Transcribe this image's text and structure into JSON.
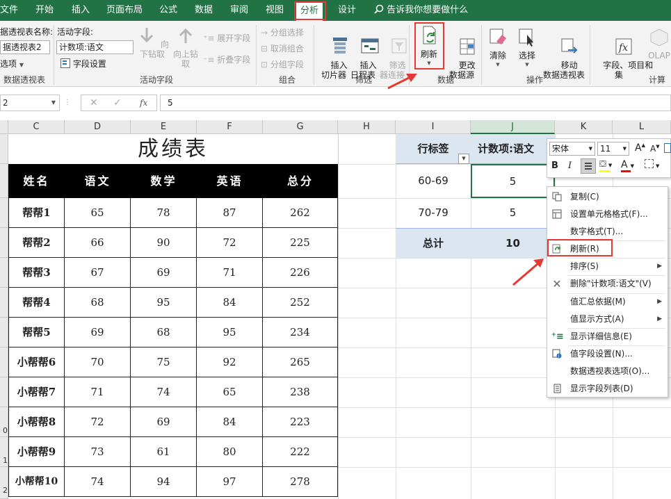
{
  "ribbon_tabs": [
    "文件",
    "开始",
    "插入",
    "页面布局",
    "公式",
    "数据",
    "审阅",
    "视图",
    "分析",
    "设计"
  ],
  "active_tab": "分析",
  "tell_me": "告诉我你想要做什么",
  "pivot": {
    "name_label": "据透视表名称:",
    "name_value": "据透视表2",
    "options_label": "选项",
    "group_label": "数据透视表"
  },
  "active_field": {
    "label": "活动字段:",
    "value": "计数项:语文",
    "settings": "字段设置",
    "drill_down": "向下钻取",
    "drill_up": "向上钻取",
    "expand": "展开字段",
    "collapse": "折叠字段",
    "group_label": "活动字段"
  },
  "group": {
    "selection": "分组选择",
    "ungroup": "取消组合",
    "field": "分组字段",
    "group_label": "组合"
  },
  "filter": {
    "slicer": "插入\n切片器",
    "timeline": "插入\n日程表",
    "connections": "筛选\n器连接",
    "group_label": "筛选"
  },
  "data": {
    "refresh": "刷新",
    "change_source": "更改\n数据源",
    "group_label": "数据"
  },
  "actions": {
    "clear": "清除",
    "select": "选择",
    "move": "移动\n数据透视表",
    "group_label": "操作"
  },
  "calc": {
    "fields": "字段、项目和\n集",
    "olap": "OLAP",
    "group_label": "计算"
  },
  "formula_bar": {
    "name_box": "2",
    "fx": "fx",
    "value": "5"
  },
  "columns": [
    "C",
    "D",
    "E",
    "F",
    "G",
    "H",
    "I",
    "J",
    "K",
    "L"
  ],
  "row_numbers": [
    "0",
    "1",
    "2"
  ],
  "table": {
    "title": "成绩表",
    "headers": [
      "姓名",
      "语文",
      "数学",
      "英语",
      "总分"
    ],
    "rows": [
      [
        "帮帮1",
        "65",
        "78",
        "87",
        "262"
      ],
      [
        "帮帮2",
        "66",
        "90",
        "72",
        "225"
      ],
      [
        "帮帮3",
        "67",
        "69",
        "71",
        "226"
      ],
      [
        "帮帮4",
        "68",
        "95",
        "84",
        "252"
      ],
      [
        "帮帮5",
        "69",
        "68",
        "95",
        "234"
      ],
      [
        "小帮帮6",
        "70",
        "75",
        "92",
        "265"
      ],
      [
        "小帮帮7",
        "71",
        "74",
        "65",
        "238"
      ],
      [
        "小帮帮8",
        "72",
        "69",
        "84",
        "223"
      ],
      [
        "小帮帮9",
        "73",
        "61",
        "80",
        "222"
      ],
      [
        "小帮帮10",
        "74",
        "94",
        "97",
        "278"
      ]
    ]
  },
  "pivot_table": {
    "row_label": "行标签",
    "value_header": "计数项:语文",
    "rows": [
      [
        "60-69",
        "5"
      ],
      [
        "70-79",
        "5"
      ]
    ],
    "total_label": "总计",
    "total_value": "10"
  },
  "mini_toolbar": {
    "font": "宋体",
    "size": "11",
    "grow": "A",
    "shrink": "A",
    "bold": "B",
    "italic": "I",
    "font_color_letter": "A"
  },
  "context_menu": [
    {
      "label": "复制(C)",
      "icon": "copy-icon",
      "submenu": false
    },
    {
      "label": "设置单元格格式(F)...",
      "icon": "format-cells-icon",
      "submenu": false
    },
    {
      "label": "数字格式(T)...",
      "icon": "",
      "submenu": false
    },
    {
      "label": "刷新(R)",
      "icon": "refresh-icon",
      "submenu": false
    },
    {
      "label": "排序(S)",
      "icon": "",
      "submenu": true
    },
    {
      "label": "删除\"计数项:语文\"(V)",
      "icon": "delete-x-icon",
      "submenu": false
    },
    {
      "label": "值汇总依据(M)",
      "icon": "",
      "submenu": true
    },
    {
      "label": "值显示方式(A)",
      "icon": "",
      "submenu": true
    },
    {
      "label": "显示详细信息(E)",
      "icon": "show-details-icon",
      "submenu": false
    },
    {
      "label": "值字段设置(N)...",
      "icon": "field-settings-icon",
      "submenu": false
    },
    {
      "label": "数据透视表选项(O)...",
      "icon": "",
      "submenu": false
    },
    {
      "label": "显示字段列表(D)",
      "icon": "field-list-icon",
      "submenu": false
    }
  ],
  "colors": {
    "excel_green": "#217346",
    "highlight_red": "#e53935",
    "pivot_header_bg": "#dce6f1"
  }
}
